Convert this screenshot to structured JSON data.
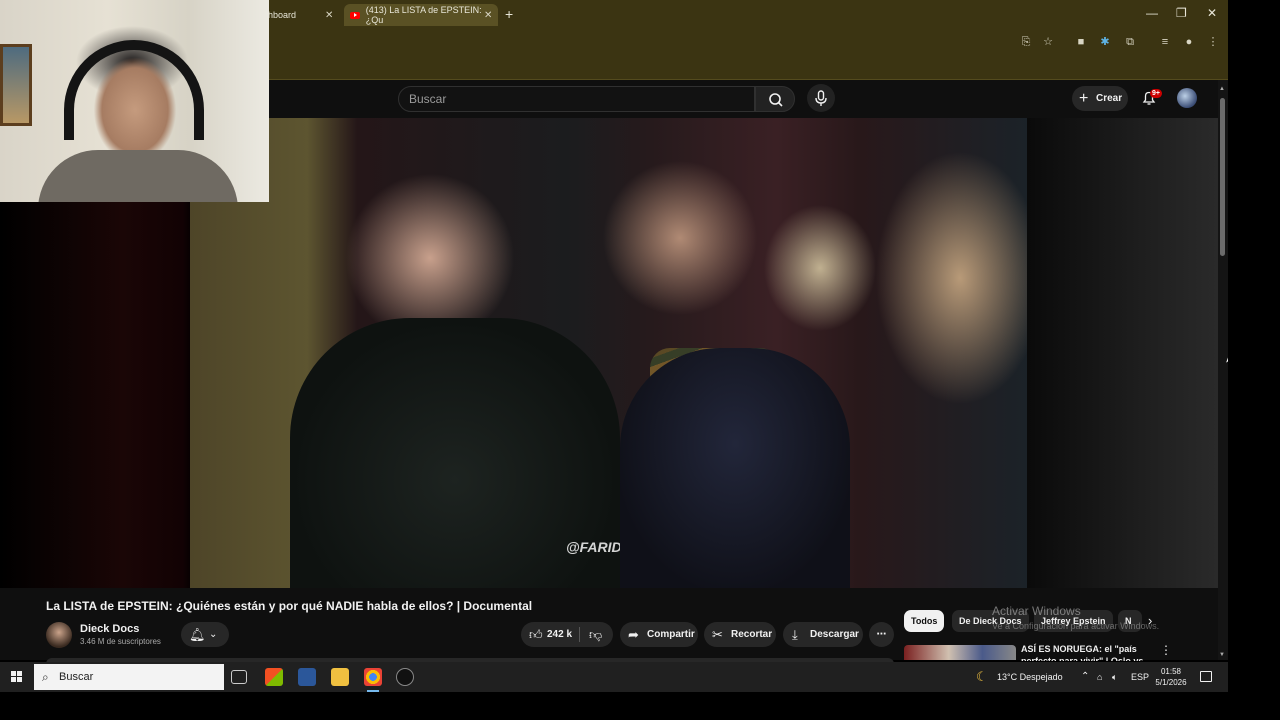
{
  "browser": {
    "tabs": [
      {
        "label": "hboard",
        "active": false
      },
      {
        "label": "(413) La LISTA de EPSTEIN: ¿Qu",
        "active": true
      }
    ],
    "new_tab": "+",
    "close_glyph": "✕",
    "window_controls": {
      "minimize": "—",
      "restore": "❐",
      "close": "✕"
    },
    "toolbar_icons": [
      "cast-icon",
      "star-icon",
      "extension-icon-1",
      "extension-icon-2",
      "extensions-puzzle-icon",
      "media-icon",
      "profile-icon",
      "menu-icon"
    ]
  },
  "masthead": {
    "search_placeholder": "Buscar",
    "create_label": "Crear",
    "notifications_badge": "9+"
  },
  "video": {
    "watermark": "@FARIDIECK"
  },
  "info": {
    "title": "La LISTA de EPSTEIN: ¿Quiénes están y por qué NADIE habla de ellos? | Documental",
    "channel_name": "Dieck Docs",
    "subscribers": "3.46 M de suscriptores",
    "likes": "242 k",
    "share_label": "Compartir",
    "clip_label": "Recortar",
    "download_label": "Descargar"
  },
  "chips": [
    {
      "label": "Todos",
      "selected": true
    },
    {
      "label": "De Dieck Docs",
      "selected": false
    },
    {
      "label": "Jeffrey Epstein",
      "selected": false
    },
    {
      "label": "N",
      "selected": false
    }
  ],
  "activation": {
    "line1": "Activar Windows",
    "line2": "Ve a Configuración para activar Windows."
  },
  "recommendation": {
    "title": "ASÍ ES NORUEGA: el \"país perfecto para vivir\" | Oslo vs"
  },
  "taskbar": {
    "search_label": "Buscar",
    "weather": "13°C  Despejado",
    "language": "ESP",
    "time": "01:58",
    "date": "5/1/2026"
  },
  "colors": {
    "browser_frame": "#3b3412",
    "youtube_bg": "#0f0f0f",
    "accent_red": "#cc0000",
    "taskbar": "#202020"
  }
}
